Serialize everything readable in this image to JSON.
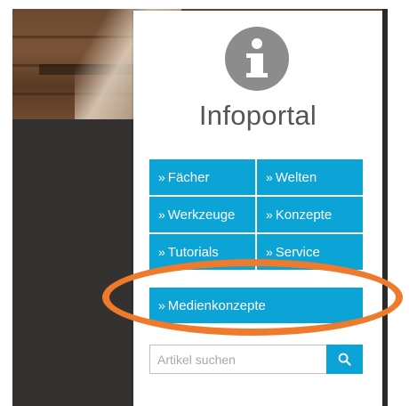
{
  "panel": {
    "icon": "info-icon",
    "title": "Infoportal"
  },
  "nav": {
    "chevron": "»",
    "items": [
      {
        "label": "Fächer"
      },
      {
        "label": "Welten"
      },
      {
        "label": "Werkzeuge"
      },
      {
        "label": "Konzepte"
      },
      {
        "label": "Tutorials"
      },
      {
        "label": "Service"
      }
    ],
    "wide_item": {
      "label": "Medienkonzepte"
    }
  },
  "search": {
    "placeholder": "Artikel suchen",
    "value": "",
    "icon": "search-icon"
  },
  "colors": {
    "accent": "#0ca3d6",
    "icon_circle": "#8c8c8c",
    "annotation": "#f07a2b"
  }
}
